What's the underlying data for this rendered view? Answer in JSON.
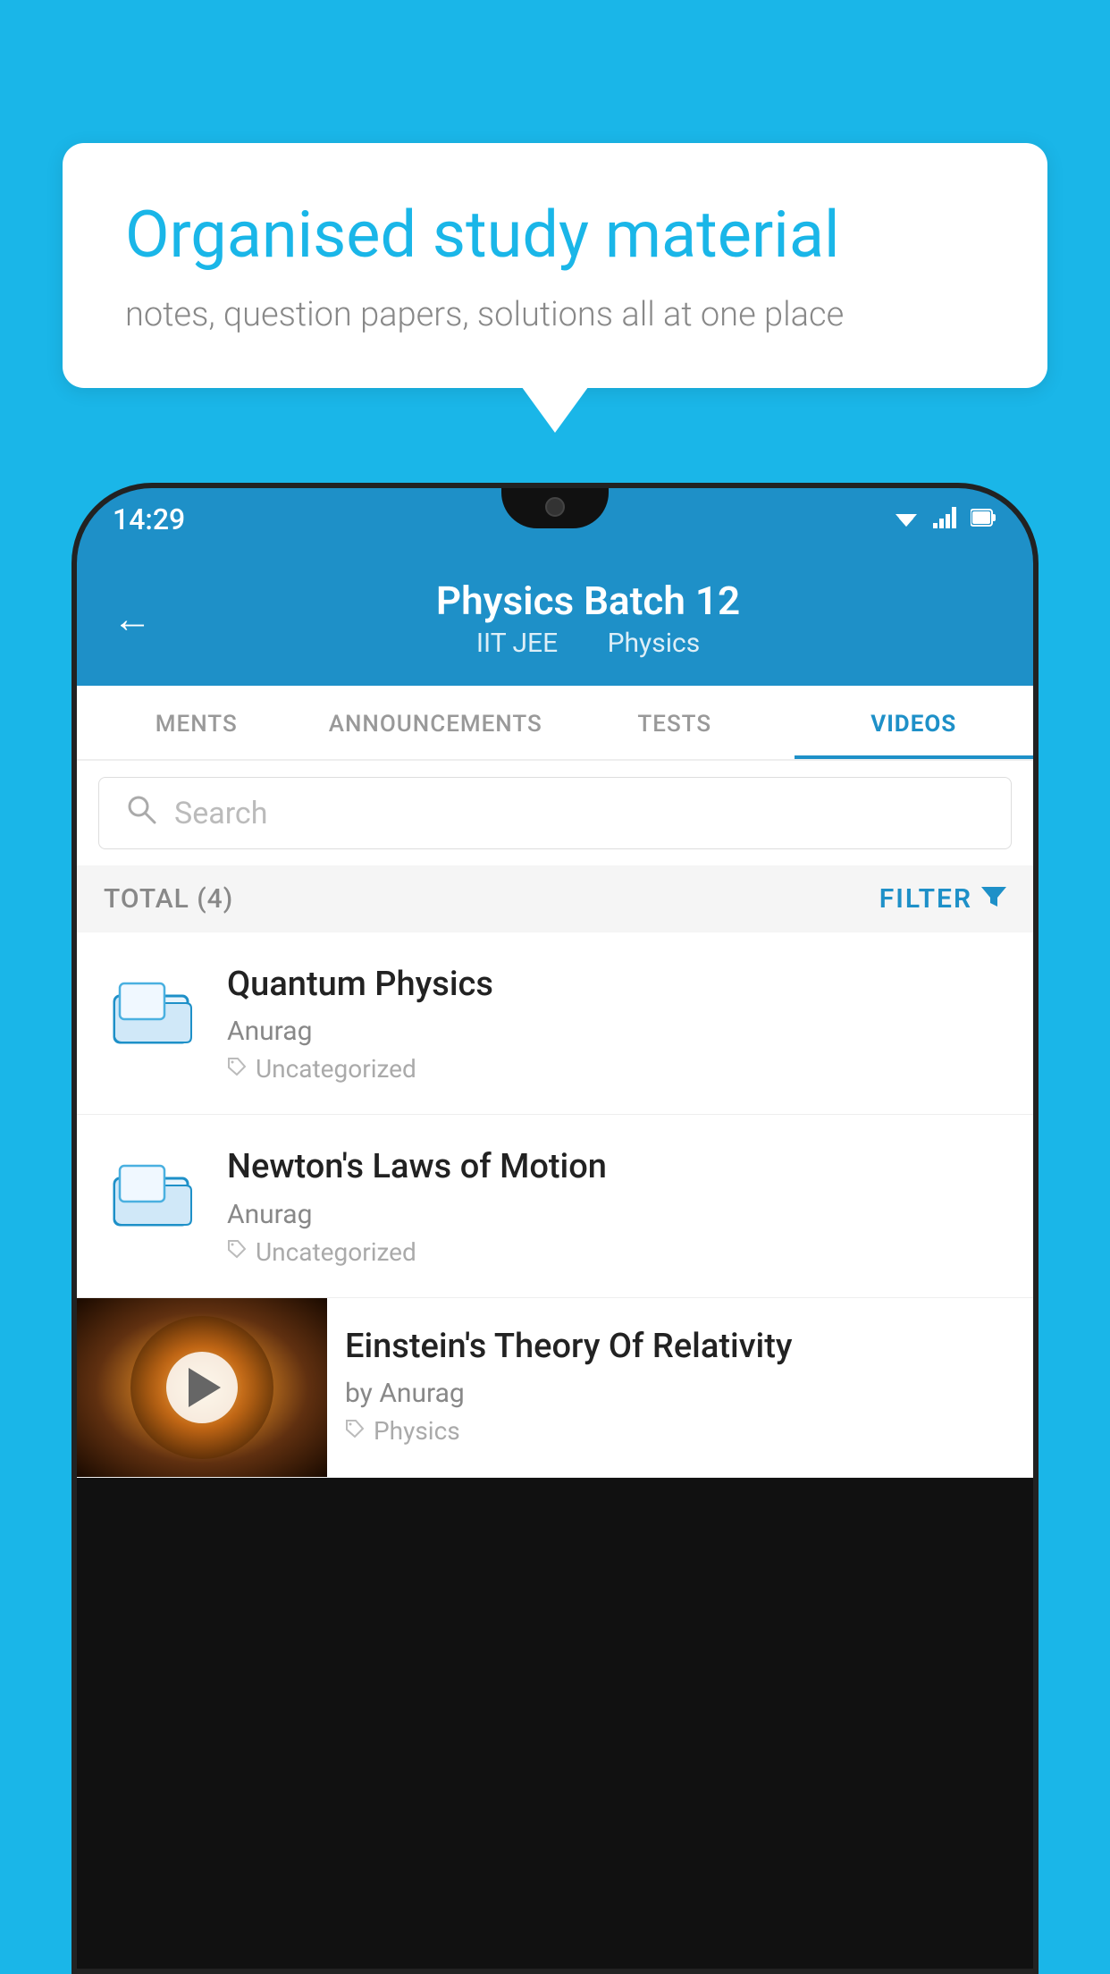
{
  "background_color": "#1ab6e8",
  "speech_bubble": {
    "title": "Organised study material",
    "subtitle": "notes, question papers, solutions all at one place"
  },
  "status_bar": {
    "time": "14:29",
    "wifi": "▼",
    "signal": "▲",
    "battery": "▮"
  },
  "app_header": {
    "back_label": "←",
    "title": "Physics Batch 12",
    "subtitle_part1": "IIT JEE",
    "subtitle_part2": "Physics"
  },
  "tabs": [
    {
      "id": "ments",
      "label": "MENTS",
      "active": false
    },
    {
      "id": "announcements",
      "label": "ANNOUNCEMENTS",
      "active": false
    },
    {
      "id": "tests",
      "label": "TESTS",
      "active": false
    },
    {
      "id": "videos",
      "label": "VIDEOS",
      "active": true
    }
  ],
  "search": {
    "placeholder": "Search"
  },
  "filter_bar": {
    "total_label": "TOTAL (4)",
    "filter_label": "FILTER"
  },
  "videos": [
    {
      "id": "quantum",
      "title": "Quantum Physics",
      "author": "Anurag",
      "tag": "Uncategorized",
      "has_thumbnail": false
    },
    {
      "id": "newton",
      "title": "Newton's Laws of Motion",
      "author": "Anurag",
      "tag": "Uncategorized",
      "has_thumbnail": false
    },
    {
      "id": "einstein",
      "title": "Einstein's Theory Of Relativity",
      "author": "by Anurag",
      "tag": "Physics",
      "has_thumbnail": true
    }
  ]
}
